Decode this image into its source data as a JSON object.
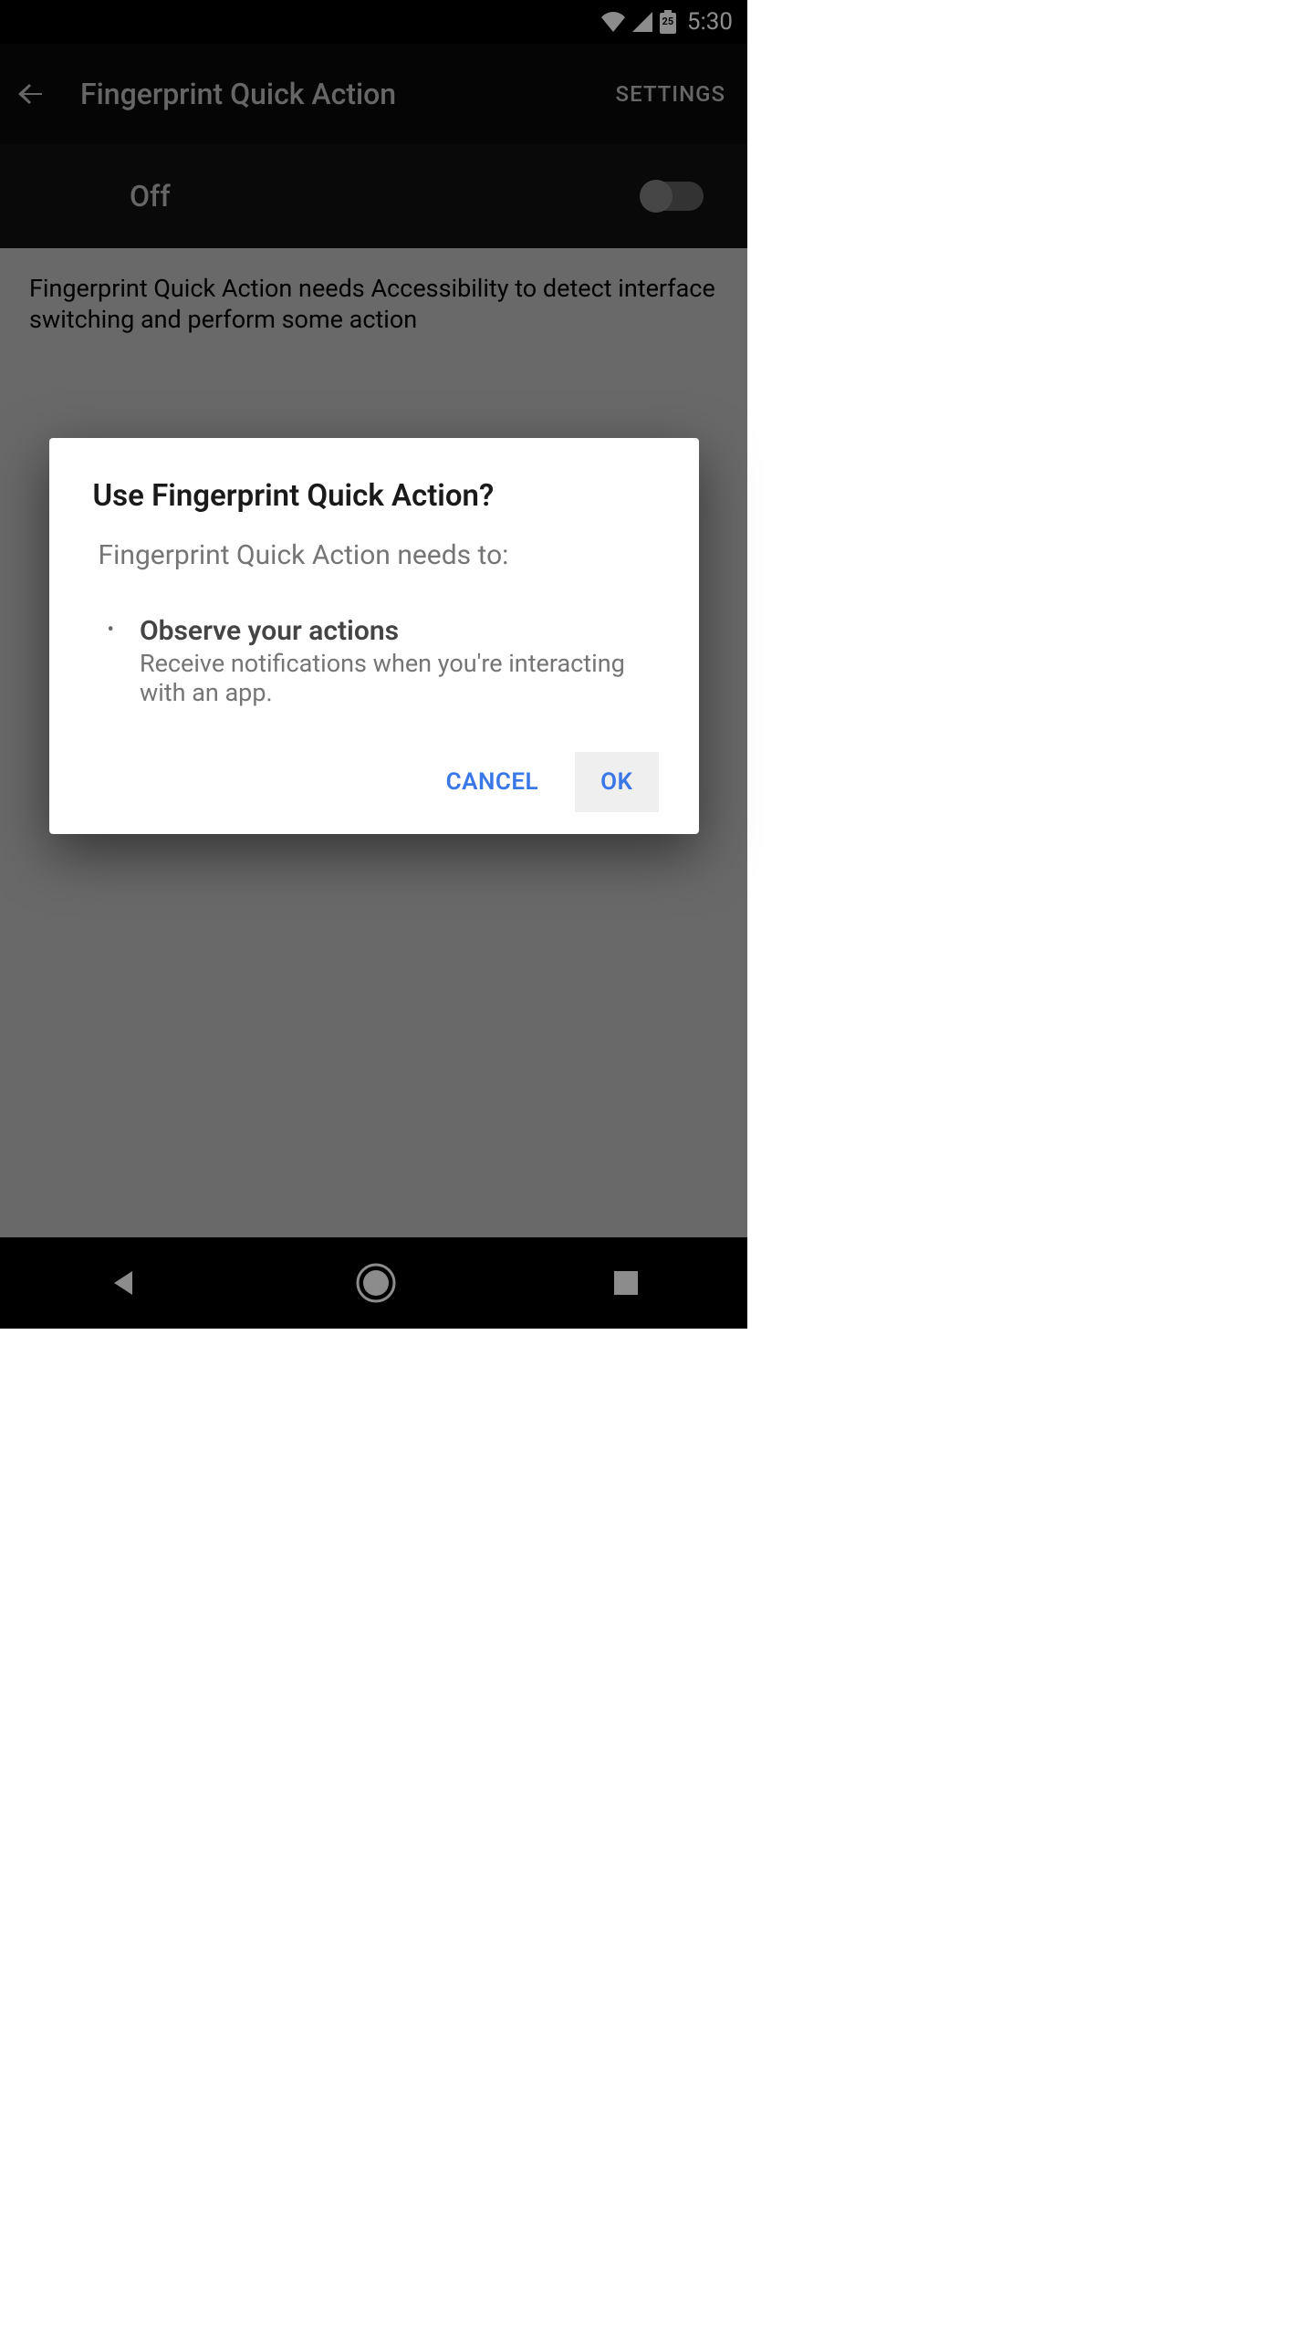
{
  "statusbar": {
    "battery_label": "25",
    "time": "5:30"
  },
  "appbar": {
    "title": "Fingerprint Quick Action",
    "settings_label": "SETTINGS"
  },
  "toggle": {
    "state_label": "Off"
  },
  "content": {
    "description": "Fingerprint Quick Action needs Accessibility to detect interface switching and perform some action"
  },
  "dialog": {
    "title": "Use Fingerprint Quick Action?",
    "subtitle": "Fingerprint Quick Action needs to:",
    "permission_title": "Observe your actions",
    "permission_desc": "Receive notifications when you're interacting with an app.",
    "cancel_label": "CANCEL",
    "ok_label": "OK"
  }
}
